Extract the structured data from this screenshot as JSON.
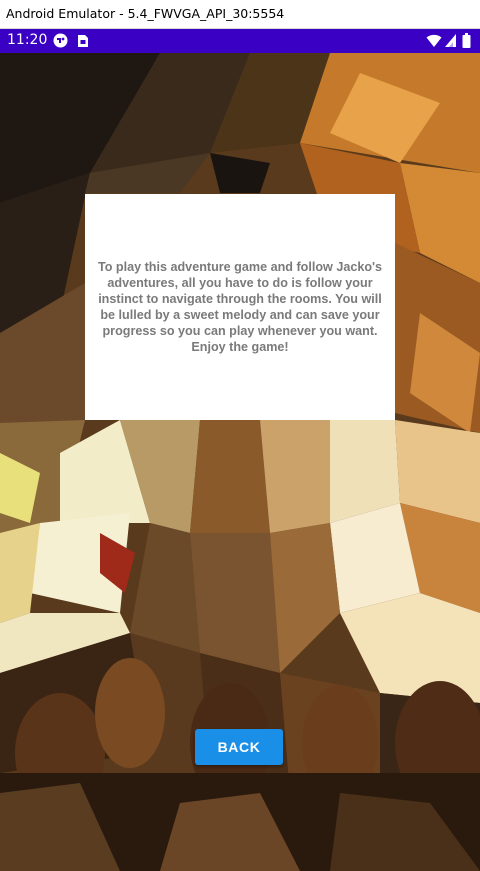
{
  "window": {
    "title": "Android Emulator - 5.4_FWVGA_API_30:5554"
  },
  "status_bar": {
    "time": "11:20",
    "background_color": "#3a00c4",
    "left_icons": [
      "game-controller-icon",
      "sim-card-icon"
    ],
    "right_icons": [
      "wifi-icon",
      "cell-signal-icon",
      "battery-icon"
    ]
  },
  "background": {
    "description_icon": "low-poly-cave-artwork"
  },
  "instructions": {
    "text": "To play this adventure game and follow Jacko's adventures, all you have to do is follow your instinct to navigate through the rooms. You will be lulled by a sweet melody and can save your progress so you can play whenever you want. Enjoy the game!"
  },
  "back_button": {
    "label": "BACK",
    "color": "#1a8fe8"
  }
}
